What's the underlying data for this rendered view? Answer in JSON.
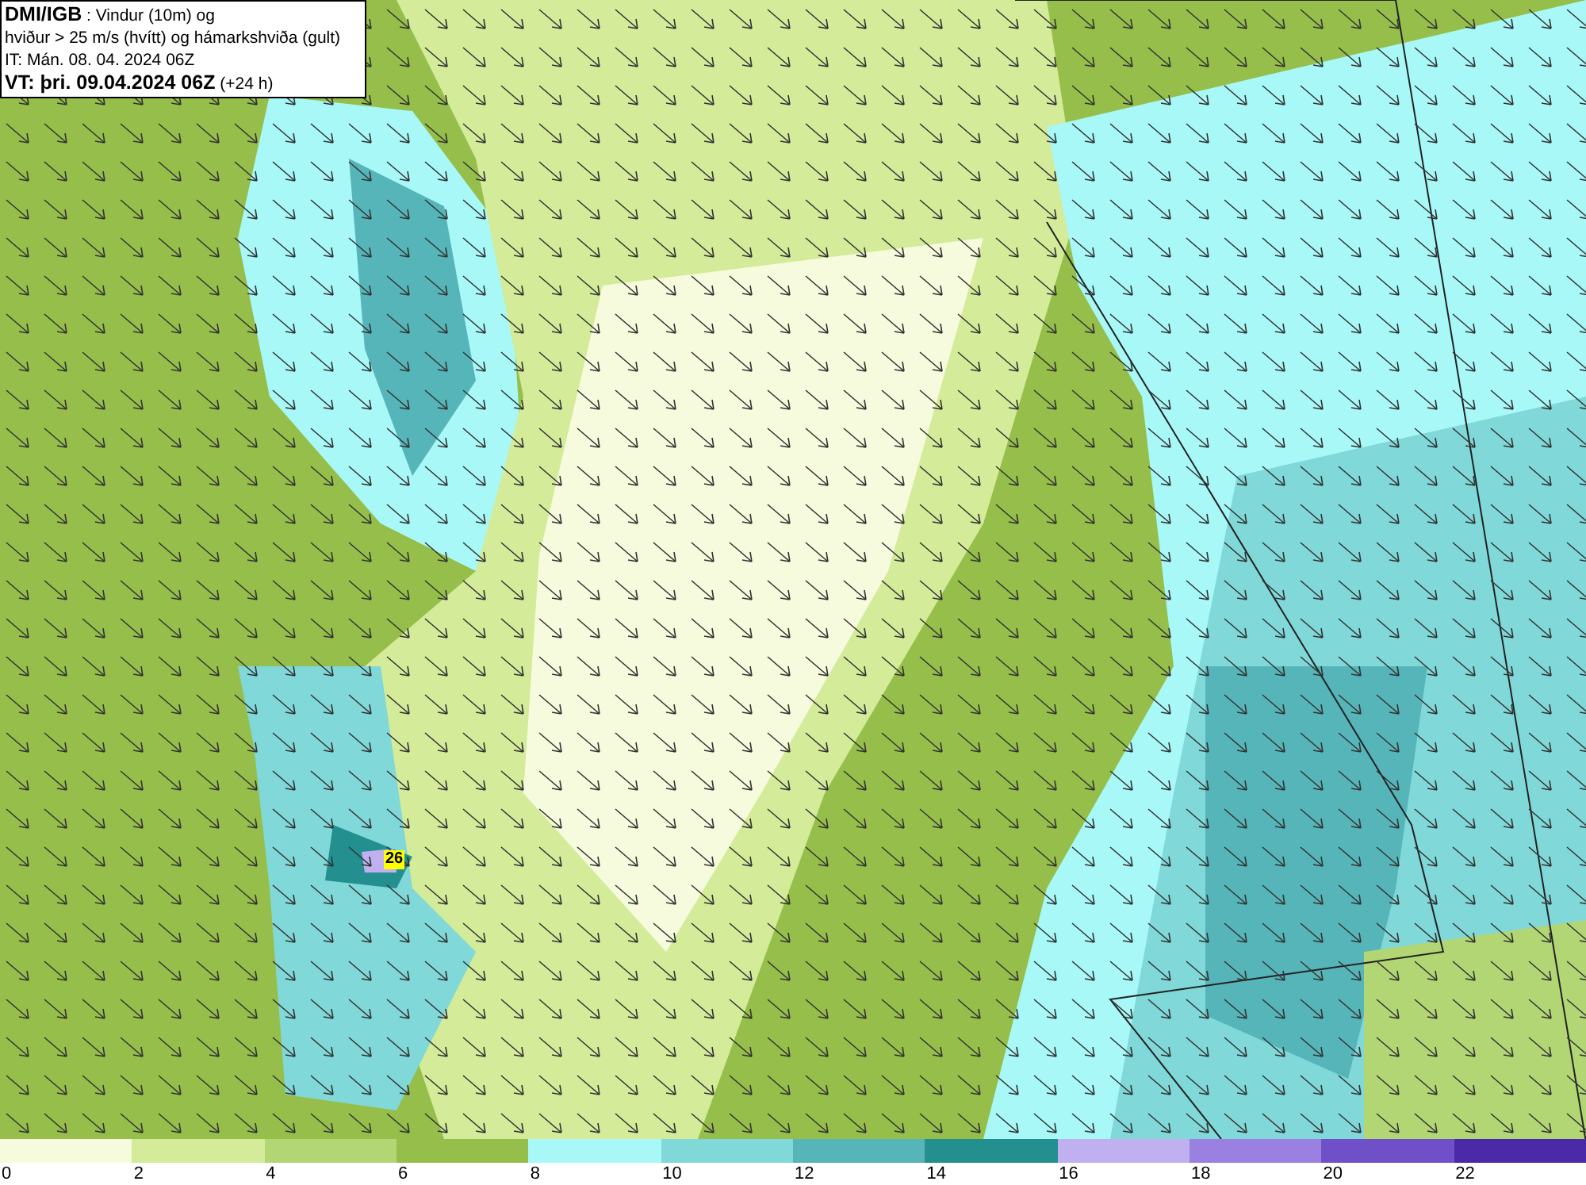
{
  "header": {
    "lines": [
      "**DMI/IGB** : Vindur (10m) og",
      "hviður > 25 m/s (hvítt) og hámarkshviða (gult)",
      "IT: Mán. 08. 04. 2024 06Z",
      "**VT: þri. 09.04.2024 06Z** (+24 h)"
    ]
  },
  "map": {
    "gust_marker": {
      "value": "26"
    }
  },
  "legend": {
    "bins": [
      {
        "label": "0",
        "color": "#f5fbdc"
      },
      {
        "label": "2",
        "color": "#d4eb9a"
      },
      {
        "label": "4",
        "color": "#b3d675"
      },
      {
        "label": "6",
        "color": "#95bf4a"
      },
      {
        "label": "8",
        "color": "#a8f8f8"
      },
      {
        "label": "10",
        "color": "#80d8d8"
      },
      {
        "label": "12",
        "color": "#56b5b8"
      },
      {
        "label": "14",
        "color": "#23908f"
      },
      {
        "label": "16",
        "color": "#c0b0f0"
      },
      {
        "label": "18",
        "color": "#9a80e0"
      },
      {
        "label": "20",
        "color": "#7050c8"
      },
      {
        "label": "22",
        "color": "#4a2aa8"
      }
    ]
  }
}
